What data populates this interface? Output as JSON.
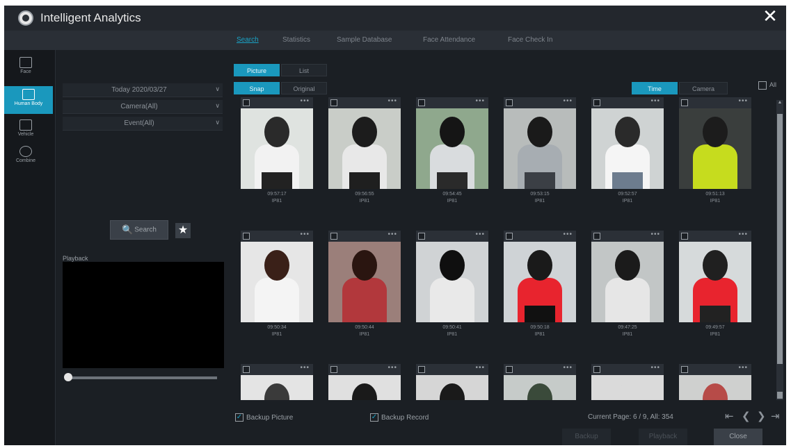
{
  "window": {
    "title": "Intelligent Analytics",
    "close_glyph": "✕"
  },
  "tabs": [
    {
      "label": "Search",
      "active": true
    },
    {
      "label": "Statistics"
    },
    {
      "label": "Sample Database"
    },
    {
      "label": "Face Attendance"
    },
    {
      "label": "Face Check In"
    }
  ],
  "side_rail": [
    {
      "label": "Face",
      "icon": "face-icon"
    },
    {
      "label": "Human Body",
      "icon": "human-body-icon",
      "active": true
    },
    {
      "label": "Vehicle",
      "icon": "vehicle-icon"
    },
    {
      "label": "Combine",
      "icon": "combine-icon"
    }
  ],
  "filters": {
    "date": "Today 2020/03/27",
    "camera": "Camera(All)",
    "event": "Event(All)",
    "caret": "∨"
  },
  "search": {
    "label": "Search",
    "icon": "🔍",
    "star_icon": "★"
  },
  "playback": {
    "label": "Playback"
  },
  "view_mode": {
    "picture": "Picture",
    "list": "List"
  },
  "image_type": {
    "snap": "Snap",
    "original": "Original"
  },
  "sort": {
    "time": "Time",
    "camera": "Camera"
  },
  "select_all_label": "All",
  "card_more": "•••",
  "cards": [
    {
      "time": "09:57:17",
      "channel": "IP81"
    },
    {
      "time": "09:56:55",
      "channel": "IP81"
    },
    {
      "time": "09:54:45",
      "channel": "IP81"
    },
    {
      "time": "09:53:15",
      "channel": "IP81"
    },
    {
      "time": "09:52:57",
      "channel": "IP81"
    },
    {
      "time": "09:51:13",
      "channel": "IP81"
    },
    {
      "time": "09:50:34",
      "channel": "IP81"
    },
    {
      "time": "09:50:44",
      "channel": "IP81"
    },
    {
      "time": "09:50:41",
      "channel": "IP81"
    },
    {
      "time": "09:50:18",
      "channel": "IP81"
    },
    {
      "time": "09:47:25",
      "channel": "IP81"
    },
    {
      "time": "09:49:57",
      "channel": "IP81"
    },
    {
      "time": "",
      "channel": ""
    },
    {
      "time": "",
      "channel": ""
    },
    {
      "time": "",
      "channel": ""
    },
    {
      "time": "",
      "channel": ""
    },
    {
      "time": "",
      "channel": ""
    },
    {
      "time": "",
      "channel": ""
    }
  ],
  "backup": {
    "picture": "Backup Picture",
    "record": "Backup Record",
    "check": "✓"
  },
  "pagination": {
    "info": "Current Page: 6 / 9, All: 354",
    "first": "⇤",
    "prev": "❮",
    "next": "❯",
    "last": "⇥"
  },
  "footer": {
    "backup": "Backup",
    "playback": "Playback",
    "close": "Close"
  },
  "colors": {
    "accent": "#1a98bd",
    "background": "#1b1f24"
  }
}
